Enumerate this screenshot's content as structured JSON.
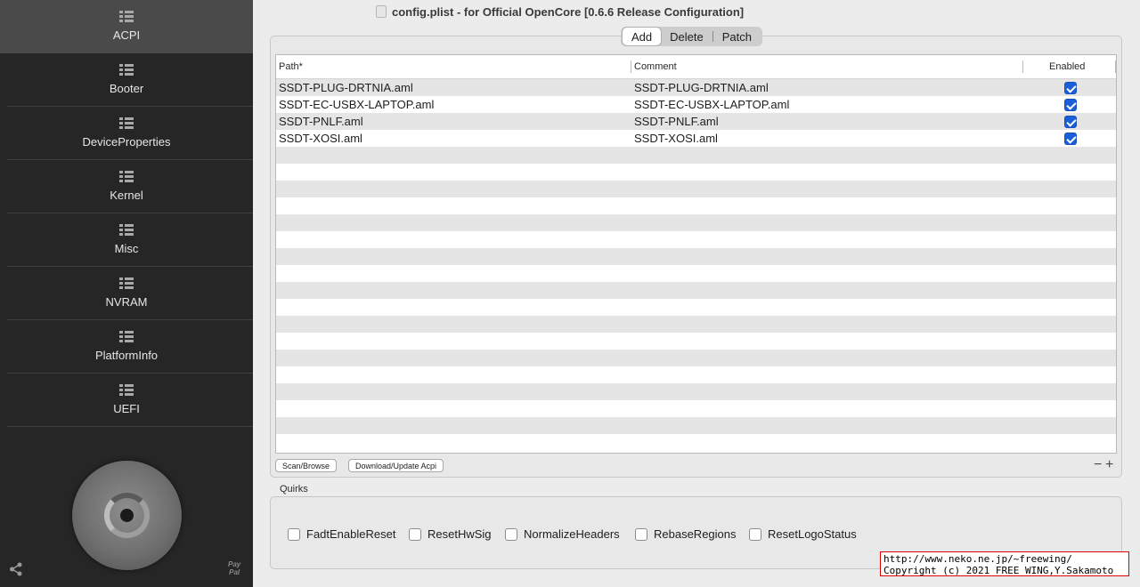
{
  "window": {
    "title": "config.plist - for Official OpenCore [0.6.6 Release Configuration]"
  },
  "sidebar": {
    "items": [
      {
        "label": "ACPI",
        "active": true
      },
      {
        "label": "Booter"
      },
      {
        "label": "DeviceProperties"
      },
      {
        "label": "Kernel"
      },
      {
        "label": "Misc"
      },
      {
        "label": "NVRAM"
      },
      {
        "label": "PlatformInfo"
      },
      {
        "label": "UEFI"
      }
    ],
    "paypal_text": "PayPal"
  },
  "tabs": {
    "add": "Add",
    "delete": "Delete",
    "patch": "Patch",
    "active": "Add"
  },
  "table": {
    "columns": {
      "path": "Path*",
      "comment": "Comment",
      "enabled": "Enabled"
    },
    "rows": [
      {
        "path": "SSDT-PLUG-DRTNIA.aml",
        "comment": "SSDT-PLUG-DRTNIA.aml",
        "enabled": true
      },
      {
        "path": "SSDT-EC-USBX-LAPTOP.aml",
        "comment": "SSDT-EC-USBX-LAPTOP.aml",
        "enabled": true
      },
      {
        "path": "SSDT-PNLF.aml",
        "comment": "SSDT-PNLF.aml",
        "enabled": true
      },
      {
        "path": "SSDT-XOSI.aml",
        "comment": "SSDT-XOSI.aml",
        "enabled": true
      }
    ],
    "empty_rows": 18
  },
  "buttons": {
    "scan": "Scan/Browse",
    "download": "Download/Update Acpi",
    "minus": "−",
    "plus": "+"
  },
  "quirks": {
    "label": "Quirks",
    "items": [
      {
        "label": "FadtEnableReset",
        "checked": false
      },
      {
        "label": "ResetHwSig",
        "checked": false
      },
      {
        "label": "NormalizeHeaders",
        "checked": false
      },
      {
        "label": "RebaseRegions",
        "checked": false
      },
      {
        "label": "ResetLogoStatus",
        "checked": false
      }
    ]
  },
  "credit": {
    "line1": "http://www.neko.ne.jp/~freewing/",
    "line2": "Copyright (c) 2021 FREE WING,Y.Sakamoto"
  },
  "colors": {
    "sidebar_bg": "#262626",
    "sidebar_active": "#4a4a4a",
    "checkbox_accent": "#1a5fd9",
    "credit_border": "#e00000"
  }
}
